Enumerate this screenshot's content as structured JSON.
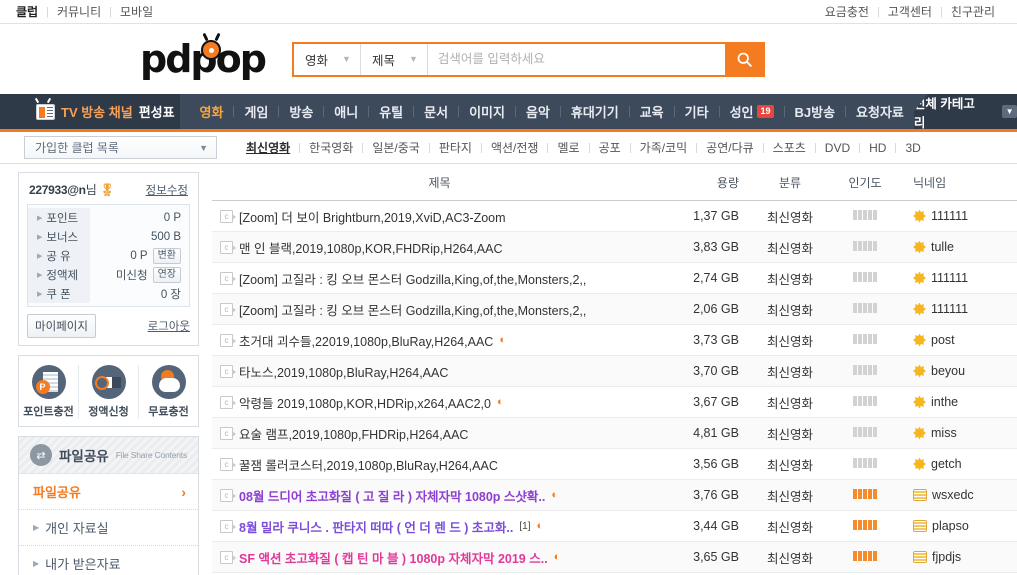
{
  "topbar": {
    "left": [
      {
        "label": "클럽",
        "bold": true
      },
      {
        "label": "커뮤니티",
        "bold": false
      },
      {
        "label": "모바일",
        "bold": false
      }
    ],
    "right": [
      {
        "label": "요금충전"
      },
      {
        "label": "고객센터"
      },
      {
        "label": "친구관리"
      }
    ]
  },
  "header": {
    "logo_text": "pdpop",
    "search": {
      "category": "영화",
      "field": "제목",
      "placeholder": "검색어를 입력하세요",
      "value": "",
      "button_icon": "search-icon"
    }
  },
  "mainnav": {
    "tv_label_a": "TV 방송 채널",
    "tv_label_b": " 편성표",
    "categories": [
      {
        "label": "영화",
        "active": true
      },
      {
        "label": "게임",
        "active": false
      },
      {
        "label": "방송",
        "active": false
      },
      {
        "label": "애니",
        "active": false
      },
      {
        "label": "유틸",
        "active": false
      },
      {
        "label": "문서",
        "active": false
      },
      {
        "label": "이미지",
        "active": false
      },
      {
        "label": "음악",
        "active": false
      },
      {
        "label": "휴대기기",
        "active": false
      },
      {
        "label": "교육",
        "active": false
      },
      {
        "label": "기타",
        "active": false
      },
      {
        "label": "성인",
        "active": false,
        "badge": "19"
      },
      {
        "label": "BJ방송",
        "active": false
      },
      {
        "label": "요청자료",
        "active": false
      }
    ],
    "all_categories": "전체 카테고리"
  },
  "subnav": {
    "club_select": "가입한 클럽 목록",
    "genres": [
      {
        "label": "최신영화",
        "active": true
      },
      {
        "label": "한국영화",
        "active": false
      },
      {
        "label": "일본/중국",
        "active": false
      },
      {
        "label": "판타지",
        "active": false
      },
      {
        "label": "액션/전쟁",
        "active": false
      },
      {
        "label": "멜로",
        "active": false
      },
      {
        "label": "공포",
        "active": false
      },
      {
        "label": "가족/코믹",
        "active": false
      },
      {
        "label": "공연/다큐",
        "active": false
      },
      {
        "label": "스포츠",
        "active": false
      },
      {
        "label": "DVD",
        "active": false
      },
      {
        "label": "HD",
        "active": false
      },
      {
        "label": "3D",
        "active": false
      }
    ]
  },
  "sidebar": {
    "user": {
      "name": "227933@n",
      "honorific": "님",
      "edit_link": "정보수정",
      "rows": [
        {
          "label": "포인트",
          "value": "0 P",
          "button": null
        },
        {
          "label": "보너스",
          "value": "500 B",
          "button": null
        },
        {
          "label": "공  유",
          "value": "0 P",
          "button": "변환"
        },
        {
          "label": "정액제",
          "value": "미신청",
          "button": "연장"
        },
        {
          "label": "쿠  폰",
          "value": "0 장",
          "button": null
        }
      ],
      "mypage_label": "마이페이지",
      "logout_label": "로그아웃"
    },
    "charge": [
      {
        "label": "포인트충전",
        "icon": "point-charge-icon"
      },
      {
        "label": "정액신청",
        "icon": "subscription-icon"
      },
      {
        "label": "무료충전",
        "icon": "free-charge-icon"
      }
    ],
    "fileshare": {
      "title_ko": "파일공유",
      "title_en": "File Share Contents",
      "items": [
        {
          "label": "파일공유",
          "active": true
        },
        {
          "label": "개인 자료실",
          "active": false
        },
        {
          "label": "내가 받은자료",
          "active": false
        }
      ]
    }
  },
  "table": {
    "headers": {
      "title": "제목",
      "size": "용량",
      "category": "분류",
      "popularity": "인기도",
      "nickname": "닉네임"
    },
    "rows": [
      {
        "title": "[Zoom] 더 보이 Brightburn,2019,XviD,AC3-Zoom",
        "size": "1,37 GB",
        "category": "최신영화",
        "pop": 0,
        "nick": "111111",
        "nick_icon": "star-badge-icon",
        "wifi": false,
        "color": "",
        "reply": ""
      },
      {
        "title": "맨 인 블랙,2019,1080p,KOR,FHDRip,H264,AAC",
        "size": "3,83 GB",
        "category": "최신영화",
        "pop": 0,
        "nick": "tulle",
        "nick_icon": "star-badge-icon",
        "wifi": false,
        "color": "",
        "reply": ""
      },
      {
        "title": "[Zoom] 고질라 : 킹 오브 몬스터 Godzilla,King,of,the,Monsters,2,,",
        "size": "2,74 GB",
        "category": "최신영화",
        "pop": 0,
        "nick": "111111",
        "nick_icon": "star-badge-icon",
        "wifi": false,
        "color": "",
        "reply": ""
      },
      {
        "title": "[Zoom] 고질라 : 킹 오브 몬스터 Godzilla,King,of,the,Monsters,2,,",
        "size": "2,06 GB",
        "category": "최신영화",
        "pop": 0,
        "nick": "111111",
        "nick_icon": "star-badge-icon",
        "wifi": false,
        "color": "",
        "reply": ""
      },
      {
        "title": "초거대 괴수들,22019,1080p,BluRay,H264,AAC",
        "size": "3,73 GB",
        "category": "최신영화",
        "pop": 0,
        "nick": "post",
        "nick_icon": "star-badge-icon",
        "wifi": true,
        "color": "",
        "reply": ""
      },
      {
        "title": "타노스,2019,1080p,BluRay,H264,AAC",
        "size": "3,70 GB",
        "category": "최신영화",
        "pop": 0,
        "nick": "beyou",
        "nick_icon": "star-badge-icon",
        "wifi": false,
        "color": "",
        "reply": ""
      },
      {
        "title": "악령들 2019,1080p,KOR,HDRip,x264,AAC2,0",
        "size": "3,67 GB",
        "category": "최신영화",
        "pop": 0,
        "nick": "inthe",
        "nick_icon": "star-badge-icon",
        "wifi": true,
        "color": "",
        "reply": ""
      },
      {
        "title": "요술 램프,2019,1080p,FHDRip,H264,AAC",
        "size": "4,81 GB",
        "category": "최신영화",
        "pop": 0,
        "nick": "miss",
        "nick_icon": "star-badge-icon",
        "wifi": false,
        "color": "",
        "reply": ""
      },
      {
        "title": "꿀잼 롤러코스터,2019,1080p,BluRay,H264,AAC",
        "size": "3,56 GB",
        "category": "최신영화",
        "pop": 0,
        "nick": "getch",
        "nick_icon": "star-badge-icon",
        "wifi": false,
        "color": "",
        "reply": ""
      },
      {
        "title": "08월 드디어 초고화질 ( 고 질 라 ) 자체자막 1080p 스샷확..",
        "size": "3,76 GB",
        "category": "최신영화",
        "pop": 5,
        "nick": "wsxedc",
        "nick_icon": "rect-badge-icon",
        "wifi": true,
        "color": "c-purple",
        "reply": ""
      },
      {
        "title": "8월 밀라 쿠니스 . 판타지 떠따 ( 언 더 렌 드 ) 초고화..",
        "size": "3,44 GB",
        "category": "최신영화",
        "pop": 5,
        "nick": "plapso",
        "nick_icon": "rect-badge-icon",
        "wifi": true,
        "color": "c-violet",
        "reply": "[1]"
      },
      {
        "title": "SF 액션 초고화질 ( 캡 틴 마 블 ) 1080p 자체자막 2019 스..",
        "size": "3,65 GB",
        "category": "최신영화",
        "pop": 5,
        "nick": "fjpdjs",
        "nick_icon": "rect-badge-icon",
        "wifi": true,
        "color": "c-pink",
        "reply": ""
      }
    ]
  },
  "colors": {
    "accent": "#f47b20",
    "navy": "#3d4a5c",
    "navy_dark": "#2f3a49",
    "category_link": "#4a7db5"
  }
}
